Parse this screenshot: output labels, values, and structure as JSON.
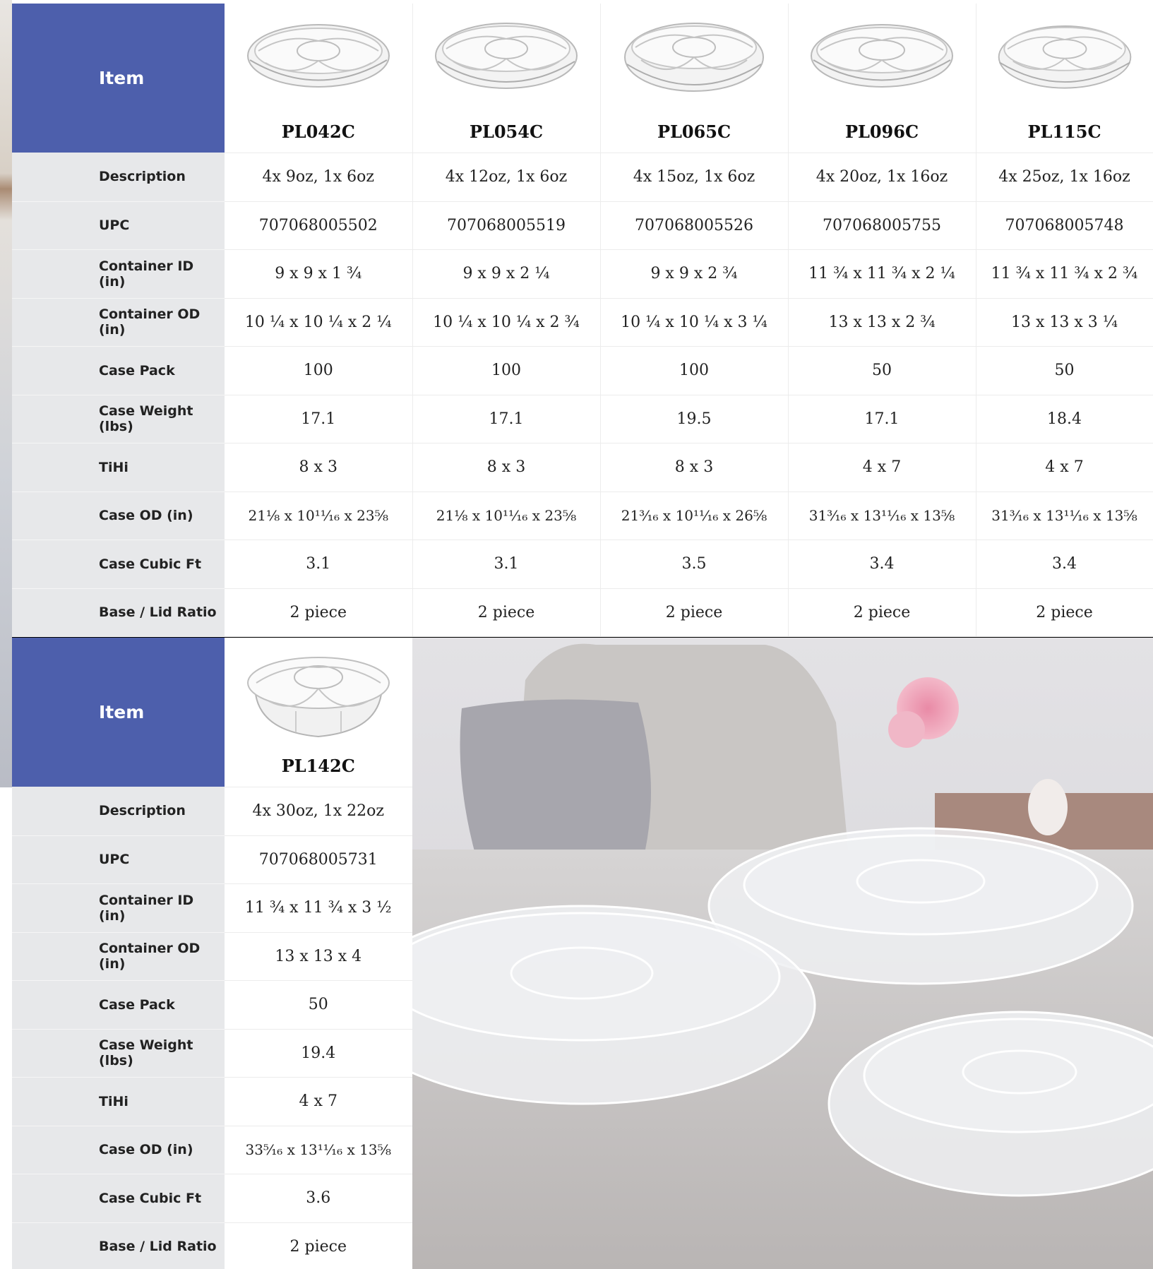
{
  "row_labels": {
    "item": "Item",
    "description": "Description",
    "upc": "UPC",
    "container_id": "Container ID (in)",
    "container_od": "Container OD (in)",
    "case_pack": "Case Pack",
    "case_weight": "Case Weight (lbs)",
    "tihi": "TiHi",
    "case_od": "Case OD (in)",
    "case_cubic": "Case Cubic Ft",
    "ratio": "Base / Lid Ratio"
  },
  "table_1": {
    "products": [
      {
        "name": "PL042C",
        "description": "4x 9oz, 1x 6oz",
        "upc": "707068005502",
        "container_id": "9 x 9 x 1 ¾",
        "container_od": "10 ¼ x 10 ¼ x 2 ¼",
        "case_pack": "100",
        "case_weight": "17.1",
        "tihi": "8 x 3",
        "case_od": "21⅛ x 10¹¹⁄₁₆ x 23⅝",
        "case_cubic": "3.1",
        "ratio": "2 piece"
      },
      {
        "name": "PL054C",
        "description": "4x 12oz, 1x 6oz",
        "upc": "707068005519",
        "container_id": "9 x 9 x 2 ¼",
        "container_od": "10 ¼ x 10 ¼ x 2 ¾",
        "case_pack": "100",
        "case_weight": "17.1",
        "tihi": "8 x 3",
        "case_od": "21⅛ x 10¹¹⁄₁₆ x 23⅝",
        "case_cubic": "3.1",
        "ratio": "2 piece"
      },
      {
        "name": "PL065C",
        "description": "4x 15oz, 1x 6oz",
        "upc": "707068005526",
        "container_id": "9 x 9 x 2 ¾",
        "container_od": "10 ¼ x 10 ¼ x 3 ¼",
        "case_pack": "100",
        "case_weight": "19.5",
        "tihi": "8 x 3",
        "case_od": "21³⁄₁₆ x 10¹¹⁄₁₆ x 26⅝",
        "case_cubic": "3.5",
        "ratio": "2 piece"
      },
      {
        "name": "PL096C",
        "description": "4x 20oz, 1x 16oz",
        "upc": "707068005755",
        "container_id": "11 ¾ x 11 ¾ x 2 ¼",
        "container_od": "13 x 13 x 2 ¾",
        "case_pack": "50",
        "case_weight": "17.1",
        "tihi": "4 x 7",
        "case_od": "31³⁄₁₆ x 13¹¹⁄₁₆ x 13⅝",
        "case_cubic": "3.4",
        "ratio": "2 piece"
      },
      {
        "name": "PL115C",
        "description": "4x 25oz, 1x 16oz",
        "upc": "707068005748",
        "container_id": "11 ¾ x 11 ¾ x 2 ¾",
        "container_od": "13 x 13 x 3 ¼",
        "case_pack": "50",
        "case_weight": "18.4",
        "tihi": "4 x 7",
        "case_od": "31³⁄₁₆ x 13¹¹⁄₁₆ x 13⅝",
        "case_cubic": "3.4",
        "ratio": "2 piece"
      }
    ]
  },
  "table_2": {
    "products": [
      {
        "name": "PL142C",
        "description": "4x 30oz, 1x 22oz",
        "upc": "707068005731",
        "container_id": "11 ¾ x 11 ¾ x 3 ½",
        "container_od": "13 x 13 x 4",
        "case_pack": "50",
        "case_weight": "19.4",
        "tihi": "4 x 7",
        "case_od": "33⁵⁄₁₆ x 13¹¹⁄₁₆ x 13⅝",
        "case_cubic": "3.6",
        "ratio": "2 piece"
      }
    ]
  },
  "icons": {
    "product_image": "clear-plastic-divided-platter",
    "lifestyle_photo": "platters-on-table-photo"
  },
  "colors": {
    "header_blue": "#4d5fac",
    "label_grey": "#e7e8ea"
  }
}
